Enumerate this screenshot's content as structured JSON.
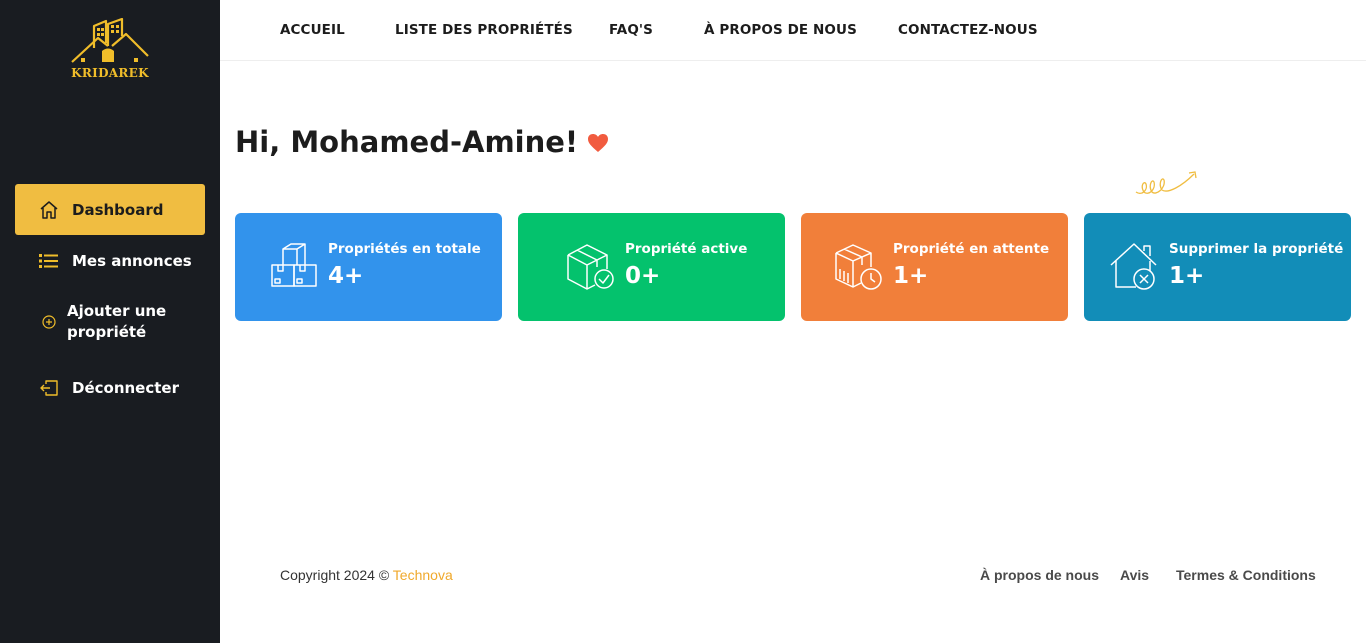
{
  "brand": {
    "logo_text": "KRIDAREK",
    "accent": "#f0bd41"
  },
  "sidebar": {
    "items": [
      {
        "label": "Dashboard",
        "icon": "home-icon",
        "active": true
      },
      {
        "label": "Mes annonces",
        "icon": "list-icon"
      },
      {
        "label": "Ajouter une propriété",
        "icon": "plus-circle-icon"
      },
      {
        "label": "Déconnecter",
        "icon": "logout-icon"
      }
    ]
  },
  "topnav": {
    "items": [
      "ACCUEIL",
      "LISTE DES PROPRIÉTÉS",
      "FAQ'S",
      "À PROPOS DE NOUS",
      "CONTACTEZ-NOUS"
    ]
  },
  "greeting": {
    "text": "Hi, Mohamed-Amine!",
    "icon": "heart-icon"
  },
  "cards": [
    {
      "title": "Propriétés en totale",
      "value": "4+",
      "color": "#3293ec",
      "icon": "boxes-icon"
    },
    {
      "title": "Propriété active",
      "value": "0+",
      "color": "#04c26d",
      "icon": "box-check-icon"
    },
    {
      "title": "Propriété en attente",
      "value": "1+",
      "color": "#f17f3a",
      "icon": "box-clock-icon"
    },
    {
      "title": "Supprimer la propriété",
      "value": "1+",
      "color": "#128db8",
      "icon": "house-remove-icon"
    }
  ],
  "footer": {
    "copyright": "Copyright 2024 © ",
    "company": "Technova",
    "links": [
      "À propos de nous",
      "Avis",
      "Termes & Conditions"
    ]
  }
}
